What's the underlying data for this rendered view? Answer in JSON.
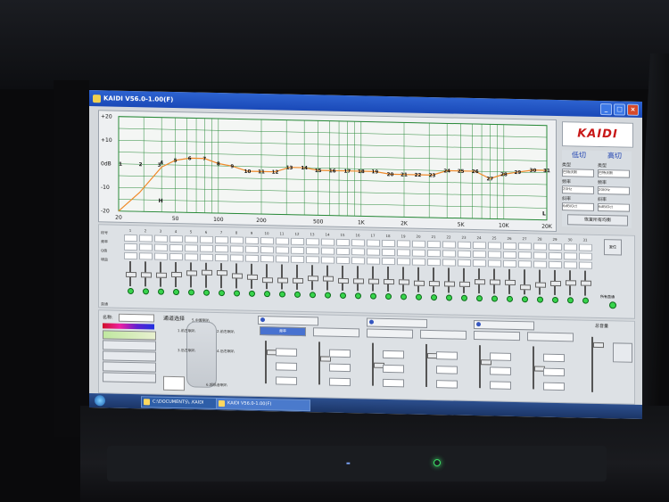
{
  "window": {
    "title": "KAIDI V56.0-1.00(F)"
  },
  "logo": {
    "text": "KAIDI"
  },
  "crossover": {
    "low": {
      "label": "低切",
      "type_label": "类型",
      "type_value": "巴特沃斯",
      "freq_label": "频率",
      "freq_value": "20Hz",
      "slope_label": "斜率",
      "slope_value": "6dB/Oct"
    },
    "high": {
      "label": "高切",
      "type_label": "类型",
      "type_value": "巴特沃斯",
      "freq_label": "频率",
      "freq_value": "20KHz",
      "slope_label": "斜率",
      "slope_value": "6dB/Oct"
    },
    "reset_label": "恢复所有均衡"
  },
  "graph": {
    "y_ticks": [
      "+20",
      "+10",
      "0dB",
      "-10",
      "-20"
    ],
    "x_ticks": [
      "20",
      "50",
      "100",
      "200",
      "500",
      "1K",
      "2K",
      "5K",
      "10K",
      "20K"
    ],
    "low_marker": "H",
    "high_marker": "L",
    "band_numbers": [
      "1",
      "2",
      "3",
      "4",
      "5",
      "6",
      "7",
      "8",
      "9",
      "10",
      "11",
      "12",
      "13",
      "14",
      "15",
      "16",
      "17",
      "18",
      "19",
      "20",
      "21",
      "22",
      "23",
      "24",
      "25",
      "26",
      "27",
      "28",
      "29",
      "30",
      "31"
    ],
    "band_levels_db": [
      0,
      0,
      0,
      1,
      2,
      3,
      3,
      1,
      0,
      -2,
      -2,
      -2,
      0,
      0,
      -1,
      -1,
      -1,
      -1,
      -1,
      -2,
      -2,
      -2,
      -2,
      0,
      0,
      0,
      -3,
      -1,
      0,
      1,
      1
    ]
  },
  "bands": {
    "row_labels": [
      "段号",
      "频率",
      "Q值",
      "增益",
      "直通"
    ],
    "right_labels": [
      "复位",
      "所有直通"
    ]
  },
  "bottom": {
    "name_label": "名称:",
    "channel_title": "通道选择",
    "left_buttons": [
      "",
      "",
      "",
      ""
    ],
    "channels": [
      "1.前左喇叭",
      "2.前右喇叭",
      "3.后左喇叭",
      "4.后右喇叭",
      "5.中置喇叭",
      "6.超低音喇叭"
    ],
    "group_tabs": [
      "",
      "",
      ""
    ],
    "param_title": "频率",
    "master_title": "总音量"
  },
  "taskbar": {
    "items": [
      "C:\\DOCUMENTS\\..KAIDI",
      "KAIDI V56.0-1.00(F)"
    ]
  },
  "colors": {
    "curve": "#f08a2a",
    "grid": "#2a8a3a",
    "title_bar": "#1a49b8",
    "led_on": "#38d44c"
  }
}
